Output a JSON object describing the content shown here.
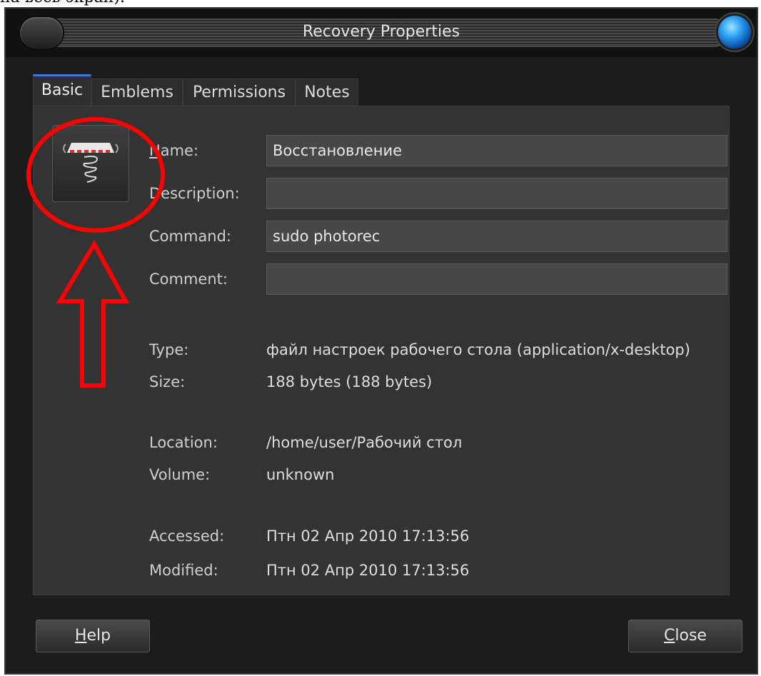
{
  "caption_fragment": "на весь экран).",
  "window": {
    "title": "Recovery Properties"
  },
  "tabs": [
    {
      "label": "Basic",
      "active": true
    },
    {
      "label": "Emblems",
      "active": false
    },
    {
      "label": "Permissions",
      "active": false
    },
    {
      "label": "Notes",
      "active": false
    }
  ],
  "form": {
    "name_label_mnemonic": "N",
    "name_label_rest": "ame:",
    "name_value": "Восстановление",
    "description_label": "Description:",
    "description_value": "",
    "command_label": "Command:",
    "command_value": "sudo photorec",
    "comment_label": "Comment:",
    "comment_value": ""
  },
  "info": {
    "type_label": "Type:",
    "type_value": "файл настроек рабочего стола (application/x-desktop)",
    "size_label": "Size:",
    "size_value": "188 bytes (188 bytes)",
    "location_label": "Location:",
    "location_value": "/home/user/Рабочий стол",
    "volume_label": "Volume:",
    "volume_value": "unknown",
    "accessed_label": "Accessed:",
    "accessed_value": "Птн 02 Апр 2010 17:13:56",
    "modified_label": "Modified:",
    "modified_value": "Птн 02 Апр 2010 17:13:56"
  },
  "buttons": {
    "help_mnemonic": "H",
    "help_rest": "elp",
    "close_mnemonic": "C",
    "close_rest": "lose"
  },
  "icons": {
    "app_icon": "spring-sign-icon",
    "window_menu": "window-menu-icon",
    "window_close": "close-orb-icon"
  },
  "colors": {
    "annotation": "#ff0000",
    "tab_accent": "#3a7ad8",
    "window_bg": "#1c1c1c",
    "panel_bg": "#333333"
  }
}
